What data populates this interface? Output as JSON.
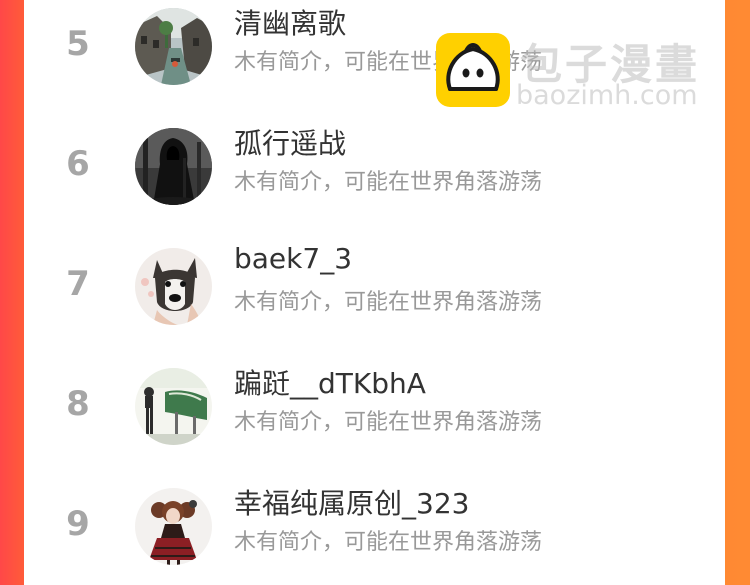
{
  "ranking": {
    "items": [
      {
        "rank": "5",
        "name": "清幽离歌",
        "intro": "木有简介，可能在世界角落游荡",
        "avatar_icon": "water-town-avatar-icon"
      },
      {
        "rank": "6",
        "name": "孤行遥战",
        "intro": "木有简介，可能在世界角落游荡",
        "avatar_icon": "hooded-figure-avatar-icon"
      },
      {
        "rank": "7",
        "name": "baek7_3",
        "intro": "木有简介，可能在世界角落游荡",
        "avatar_icon": "husky-dog-avatar-icon"
      },
      {
        "rank": "8",
        "name": "蹁跹__dTKbhA",
        "intro": "木有简介，可能在世界角落游荡",
        "avatar_icon": "anime-scene-avatar-icon"
      },
      {
        "rank": "9",
        "name": "幸福纯属原创_323",
        "intro": "木有简介，可能在世界角落游荡",
        "avatar_icon": "lolita-doll-avatar-icon"
      }
    ]
  },
  "watermark": {
    "site_name": "包子漫畫",
    "url": "baozimh.com",
    "logo_icon": "bun-mascot-icon"
  },
  "colors": {
    "rank_gray": "#a6a6a6",
    "name_text": "#333333",
    "intro_text": "#999999",
    "frame_left": "#ff4848",
    "frame_right": "#ff8a33",
    "logo_yellow": "#ffd000"
  }
}
